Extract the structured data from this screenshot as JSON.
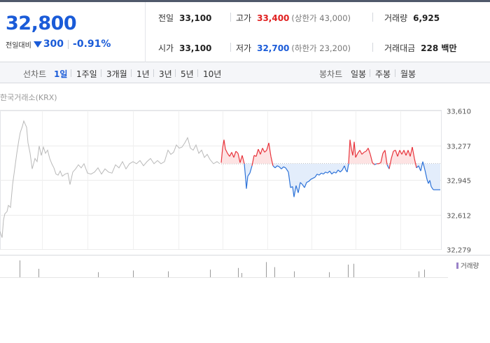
{
  "summary": {
    "price": "32,800",
    "change_label": "전일대비",
    "change": "300",
    "change_pct": "-0.91%",
    "stats": {
      "prev_close": {
        "label": "전일",
        "value": "33,100"
      },
      "high": {
        "label": "고가",
        "value": "33,400",
        "limit_label": "(상한가 43,000)"
      },
      "volume": {
        "label": "거래량",
        "value": "6,925"
      },
      "open": {
        "label": "시가",
        "value": "33,100"
      },
      "low": {
        "label": "저가",
        "value": "32,700",
        "limit_label": "(하한가 23,200)"
      },
      "amount": {
        "label": "거래대금",
        "value": "228 백만"
      }
    }
  },
  "toolbar": {
    "line_chart_label": "선차트",
    "line_periods": [
      "1일",
      "1주일",
      "3개월",
      "1년",
      "3년",
      "5년",
      "10년"
    ],
    "active_period": "1일",
    "candle_chart_label": "봉차트",
    "candle_periods": [
      "일봉",
      "주봉",
      "월봉"
    ]
  },
  "chart": {
    "source_label": "한국거래소(KRX)",
    "volume_legend": "거래량",
    "colors": {
      "up": "#e8343c",
      "down": "#2c72d8",
      "pre": "#b9b9b9",
      "up_fill": "#fde3e3",
      "down_fill": "#e3edfb",
      "volume": "#9a82c8"
    }
  },
  "chart_data": {
    "type": "line",
    "y_ticks": [
      "33,610",
      "33,277",
      "32,945",
      "32,612",
      "32,279"
    ],
    "ylim": [
      32279,
      33610
    ],
    "baseline": 33100,
    "x_count": 420,
    "pre_series": [
      [
        0,
        32450
      ],
      [
        3,
        32390
      ],
      [
        5,
        32560
      ],
      [
        7,
        32620
      ],
      [
        10,
        32640
      ],
      [
        12,
        32700
      ],
      [
        15,
        32680
      ],
      [
        18,
        32900
      ],
      [
        21,
        33050
      ],
      [
        24,
        33200
      ],
      [
        27,
        33330
      ],
      [
        29,
        33400
      ],
      [
        32,
        33460
      ],
      [
        34,
        33510
      ],
      [
        36,
        33480
      ],
      [
        38,
        33450
      ],
      [
        40,
        33300
      ],
      [
        43,
        33200
      ],
      [
        46,
        33050
      ],
      [
        50,
        33150
      ],
      [
        53,
        33120
      ],
      [
        56,
        33270
      ],
      [
        59,
        33180
      ],
      [
        62,
        33260
      ],
      [
        65,
        33200
      ],
      [
        68,
        33230
      ],
      [
        71,
        33150
      ],
      [
        74,
        33100
      ],
      [
        77,
        33060
      ],
      [
        80,
        33000
      ],
      [
        83,
        32990
      ],
      [
        86,
        33030
      ],
      [
        89,
        32980
      ],
      [
        93,
        33000
      ],
      [
        97,
        33010
      ],
      [
        100,
        32900
      ],
      [
        104,
        33020
      ],
      [
        108,
        33050
      ],
      [
        112,
        33090
      ],
      [
        116,
        33060
      ],
      [
        120,
        33100
      ],
      [
        125,
        33010
      ],
      [
        130,
        33000
      ],
      [
        135,
        33020
      ],
      [
        140,
        33060
      ],
      [
        145,
        33000
      ],
      [
        150,
        33050
      ],
      [
        155,
        33020
      ],
      [
        160,
        33010
      ],
      [
        165,
        33090
      ],
      [
        170,
        33060
      ],
      [
        175,
        33120
      ],
      [
        180,
        33050
      ],
      [
        185,
        33100
      ],
      [
        190,
        33120
      ],
      [
        195,
        33100
      ],
      [
        200,
        33130
      ],
      [
        205,
        33080
      ],
      [
        210,
        33120
      ],
      [
        215,
        33150
      ],
      [
        220,
        33100
      ],
      [
        225,
        33130
      ],
      [
        230,
        33100
      ],
      [
        235,
        33120
      ],
      [
        240,
        33230
      ],
      [
        244,
        33190
      ],
      [
        248,
        33210
      ],
      [
        252,
        33280
      ],
      [
        256,
        33250
      ],
      [
        260,
        33260
      ],
      [
        264,
        33300
      ],
      [
        268,
        33350
      ],
      [
        272,
        33250
      ],
      [
        276,
        33230
      ],
      [
        280,
        33280
      ],
      [
        284,
        33200
      ],
      [
        288,
        33230
      ],
      [
        292,
        33160
      ],
      [
        296,
        33190
      ],
      [
        300,
        33140
      ],
      [
        305,
        33100
      ],
      [
        310,
        33120
      ],
      [
        314,
        33100
      ]
    ],
    "day_series": [
      [
        316,
        33110
      ],
      [
        318,
        33250
      ],
      [
        320,
        33330
      ],
      [
        322,
        33240
      ],
      [
        325,
        33200
      ],
      [
        328,
        33170
      ],
      [
        331,
        33210
      ],
      [
        334,
        33160
      ],
      [
        337,
        33220
      ],
      [
        340,
        33200
      ],
      [
        343,
        33110
      ],
      [
        346,
        33180
      ],
      [
        349,
        33100
      ],
      [
        351,
        32950
      ],
      [
        352,
        32860
      ],
      [
        354,
        32980
      ],
      [
        357,
        33010
      ],
      [
        360,
        33080
      ],
      [
        363,
        33180
      ],
      [
        366,
        33170
      ],
      [
        369,
        33240
      ],
      [
        372,
        33190
      ],
      [
        375,
        33250
      ],
      [
        378,
        33210
      ],
      [
        381,
        33230
      ],
      [
        384,
        33300
      ],
      [
        387,
        33170
      ],
      [
        390,
        33080
      ],
      [
        393,
        33060
      ],
      [
        396,
        33080
      ],
      [
        399,
        33070
      ],
      [
        402,
        33050
      ],
      [
        405,
        33070
      ],
      [
        408,
        33060
      ],
      [
        412,
        33020
      ],
      [
        415,
        32870
      ],
      [
        418,
        32880
      ],
      [
        420,
        32780
      ],
      [
        423,
        32890
      ],
      [
        426,
        32820
      ],
      [
        429,
        32920
      ],
      [
        432,
        32900
      ],
      [
        435,
        32870
      ],
      [
        438,
        32920
      ],
      [
        441,
        32930
      ],
      [
        444,
        32950
      ],
      [
        447,
        32960
      ],
      [
        450,
        32970
      ],
      [
        453,
        33000
      ],
      [
        456,
        32990
      ],
      [
        459,
        33010
      ],
      [
        462,
        33000
      ],
      [
        465,
        33020
      ],
      [
        468,
        33010
      ],
      [
        471,
        33030
      ],
      [
        474,
        33000
      ],
      [
        477,
        33020
      ],
      [
        480,
        33010
      ],
      [
        483,
        33040
      ],
      [
        486,
        33020
      ],
      [
        489,
        33040
      ],
      [
        492,
        33080
      ],
      [
        494,
        33040
      ],
      [
        496,
        33020
      ],
      [
        498,
        33100
      ],
      [
        500,
        33330
      ],
      [
        502,
        33240
      ],
      [
        504,
        33180
      ],
      [
        506,
        33310
      ],
      [
        508,
        33160
      ],
      [
        511,
        33200
      ],
      [
        514,
        33230
      ],
      [
        517,
        33190
      ],
      [
        520,
        33210
      ],
      [
        523,
        33220
      ],
      [
        526,
        33250
      ],
      [
        529,
        33190
      ],
      [
        532,
        33110
      ],
      [
        535,
        33090
      ],
      [
        538,
        33100
      ],
      [
        541,
        33100
      ],
      [
        544,
        33110
      ],
      [
        547,
        33200
      ],
      [
        550,
        33230
      ],
      [
        553,
        33090
      ],
      [
        556,
        33050
      ],
      [
        559,
        33150
      ],
      [
        562,
        33220
      ],
      [
        565,
        33230
      ],
      [
        568,
        33170
      ],
      [
        571,
        33230
      ],
      [
        574,
        33190
      ],
      [
        577,
        33230
      ],
      [
        580,
        33180
      ],
      [
        583,
        33230
      ],
      [
        586,
        33170
      ],
      [
        589,
        33260
      ],
      [
        592,
        33150
      ],
      [
        595,
        33060
      ],
      [
        598,
        33080
      ],
      [
        601,
        33030
      ],
      [
        604,
        33120
      ],
      [
        607,
        33040
      ],
      [
        610,
        32950
      ],
      [
        612,
        32910
      ],
      [
        614,
        32940
      ],
      [
        616,
        32880
      ],
      [
        619,
        32850
      ],
      [
        623,
        32850
      ],
      [
        629,
        32850
      ]
    ],
    "volume_bars": [
      [
        28,
        1.0
      ],
      [
        55,
        0.5
      ],
      [
        140,
        0.3
      ],
      [
        190,
        0.4
      ],
      [
        240,
        0.35
      ],
      [
        300,
        0.45
      ],
      [
        340,
        0.55
      ],
      [
        345,
        0.25
      ],
      [
        380,
        0.9
      ],
      [
        392,
        0.6
      ],
      [
        420,
        0.35
      ],
      [
        470,
        0.3
      ],
      [
        497,
        0.75
      ],
      [
        505,
        0.8
      ],
      [
        598,
        0.35
      ],
      [
        606,
        0.45
      ]
    ],
    "volume_max_label": ""
  }
}
